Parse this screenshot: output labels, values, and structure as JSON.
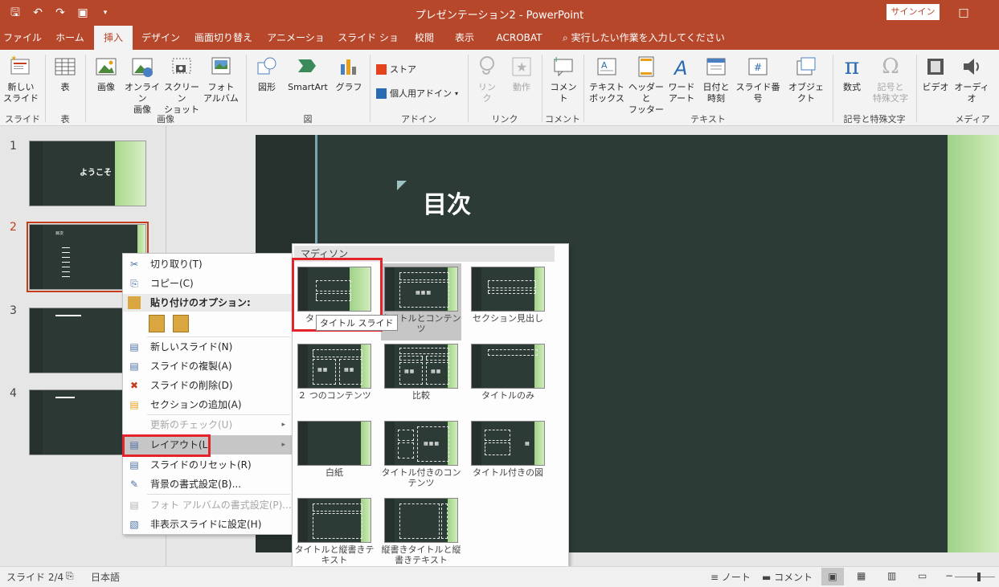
{
  "titlebar": {
    "title": "プレゼンテーション2  -  PowerPoint",
    "signin": "サインイン",
    "qat_icons": [
      "save-icon",
      "undo-icon",
      "redo-icon",
      "start-from-beginning-icon",
      "customize-qat-icon"
    ]
  },
  "tabs": [
    "ファイル",
    "ホーム",
    "挿入",
    "デザイン",
    "画面切り替え",
    "アニメーション",
    "スライド ショー",
    "校閲",
    "表示",
    "ACROBAT"
  ],
  "active_tab": "挿入",
  "tellme": "実行したい作業を入力してください",
  "ribbon": {
    "new_slide": "新しい\nスライド",
    "table": "表",
    "image": "画像",
    "online_image": "オンライン\n画像",
    "screenshot": "スクリーン\nショット",
    "photo_album": "フォト\nアルバム",
    "shape": "図形",
    "smartart": "SmartArt",
    "graph": "グラフ",
    "store": "ストア",
    "my_addins": "個人用アドイン",
    "link": "リン\nク",
    "action": "動作",
    "comment": "コメント",
    "textbox": "テキスト\nボックス",
    "header_footer": "ヘッダーと\nフッター",
    "wordart": "ワード\nアート",
    "datetime": "日付と\n時刻",
    "slide_number": "スライド番号",
    "object": "オブジェクト",
    "equation": "数式",
    "symbol": "記号と\n特殊文字",
    "video": "ビデオ",
    "audio": "オーディオ",
    "groups": {
      "slide": "スライド",
      "table": "表",
      "image": "画像",
      "figure": "図",
      "addin": "アドイン",
      "link": "リンク",
      "comment": "コメント",
      "text": "テキスト",
      "symbols": "記号と特殊文字",
      "media": "メディア"
    }
  },
  "thumbnails": [
    {
      "num": "1",
      "title": "ようこそ"
    },
    {
      "num": "2",
      "title": "目次"
    },
    {
      "num": "3",
      "title": ""
    },
    {
      "num": "4",
      "title": ""
    }
  ],
  "slide": {
    "title": "目次"
  },
  "context_menu": {
    "cut": "切り取り(T)",
    "copy": "コピー(C)",
    "paste_header": "貼り付けのオプション:",
    "new_slide": "新しいスライド(N)",
    "duplicate": "スライドの複製(A)",
    "delete": "スライドの削除(D)",
    "add_section": "セクションの追加(A)",
    "check_update": "更新のチェック(U)",
    "layout": "レイアウト(L)",
    "reset": "スライドのリセット(R)",
    "background": "背景の書式設定(B)...",
    "photo_album": "フォト アルバムの書式設定(P)...",
    "hide": "非表示スライドに設定(H)"
  },
  "gallery": {
    "theme": "マディソン",
    "layouts": [
      "タイトル スライド",
      "タイトルとコンテンツ",
      "セクション見出し",
      "２ つのコンテンツ",
      "比較",
      "タイトルのみ",
      "白紙",
      "タイトル付きのコンテンツ",
      "タイトル付きの図",
      "タイトルと縦書きテキスト",
      "縦書きタイトルと縦書きテキスト"
    ],
    "tooltip": "タイトル スライド",
    "first_label_visible": "タ"
  },
  "statusbar": {
    "slide": "スライド 2/4",
    "language": "日本語",
    "notes": "ノート",
    "comments": "コメント"
  }
}
